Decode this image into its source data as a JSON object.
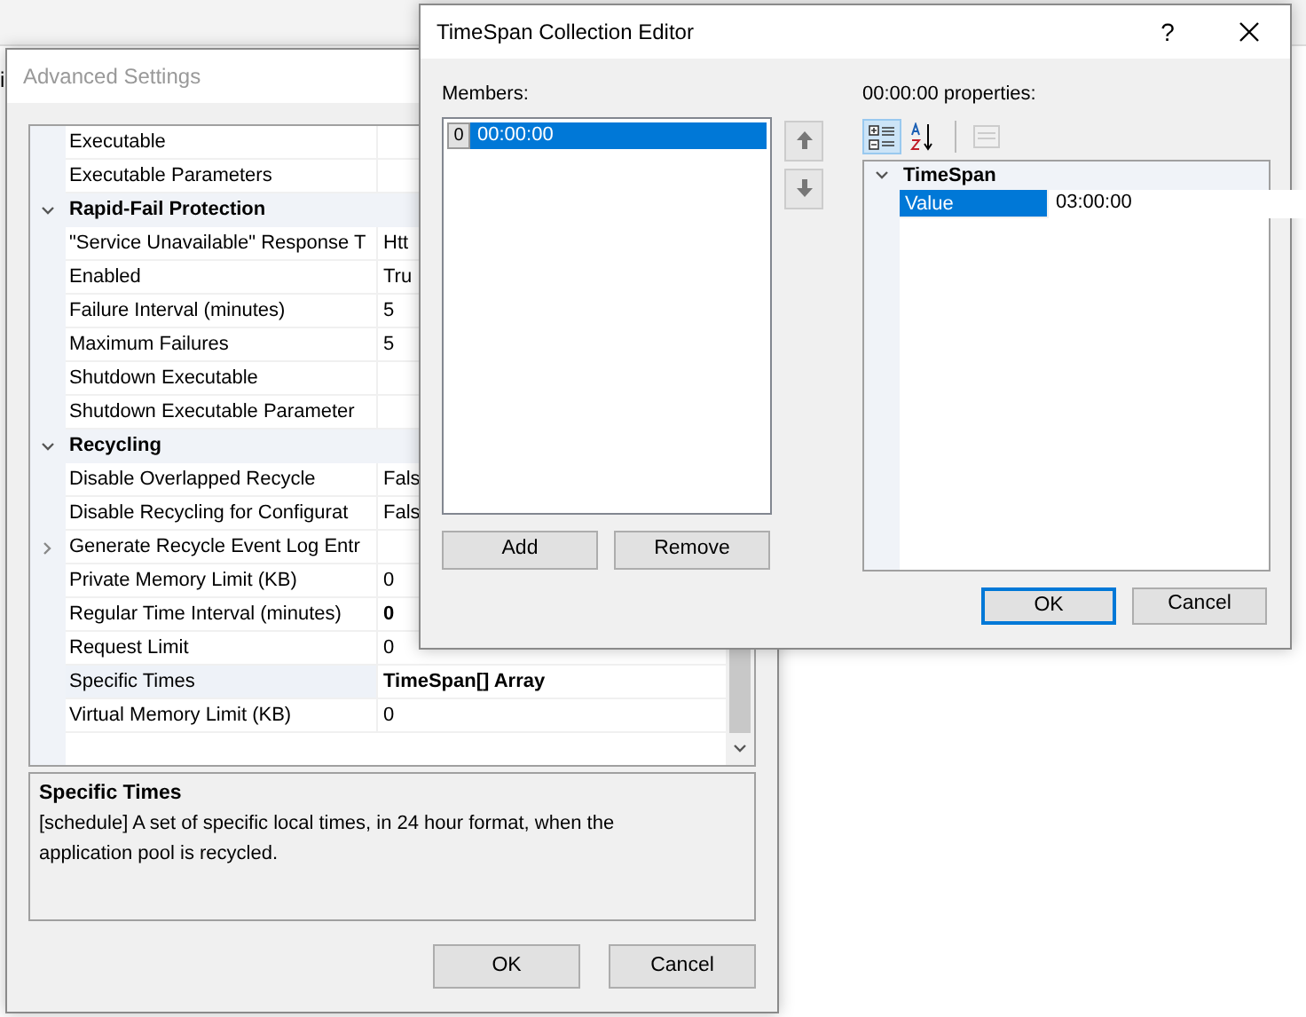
{
  "background_window": {
    "title": "i"
  },
  "advanced_settings": {
    "title": "Advanced Settings",
    "rows": [
      {
        "kind": "property",
        "label": "Executable",
        "selected": false
      },
      {
        "kind": "property",
        "label": "Executable Parameters",
        "selected": false
      },
      {
        "kind": "category",
        "label": "Rapid-Fail Protection",
        "expanded": true
      },
      {
        "kind": "property",
        "label": "\"Service Unavailable\" Response T",
        "value": "Htt",
        "modified": false,
        "selected": false
      },
      {
        "kind": "property",
        "label": "Enabled",
        "value": "Tru",
        "modified": false,
        "selected": false
      },
      {
        "kind": "property",
        "label": "Failure Interval (minutes)",
        "value": "5",
        "modified": false,
        "selected": false
      },
      {
        "kind": "property",
        "label": "Maximum Failures",
        "value": "5",
        "modified": false,
        "selected": false
      },
      {
        "kind": "property",
        "label": "Shutdown Executable",
        "selected": false
      },
      {
        "kind": "property",
        "label": "Shutdown Executable Parameter",
        "selected": false
      },
      {
        "kind": "category",
        "label": "Recycling",
        "expanded": true
      },
      {
        "kind": "property",
        "label": "Disable Overlapped Recycle",
        "value": "Fals",
        "modified": false,
        "selected": false
      },
      {
        "kind": "property",
        "label": "Disable Recycling for Configurat",
        "value": "Fals",
        "modified": false,
        "selected": false
      },
      {
        "kind": "group",
        "label": "Generate Recycle Event Log Entr",
        "expanded": false
      },
      {
        "kind": "property",
        "label": "Private Memory Limit (KB)",
        "value": "0",
        "modified": false,
        "selected": false
      },
      {
        "kind": "property",
        "label": "Regular Time Interval (minutes)",
        "value": "0",
        "modified": true,
        "selected": false
      },
      {
        "kind": "property",
        "label": "Request Limit",
        "value": "0",
        "modified": false,
        "selected": false
      },
      {
        "kind": "property",
        "label": "Specific Times",
        "value": "TimeSpan[] Array",
        "modified": true,
        "selected": true
      },
      {
        "kind": "property",
        "label": "Virtual Memory Limit (KB)",
        "value": "0",
        "modified": false,
        "selected": false
      }
    ],
    "description": {
      "title": "Specific Times",
      "text": "[schedule] A set of specific local times, in 24 hour format, when the application pool is recycled."
    },
    "buttons": [
      "OK",
      "Cancel"
    ]
  },
  "collection_editor": {
    "title": "TimeSpan Collection Editor",
    "help": "?",
    "members_label": "Members:",
    "members": [
      {
        "index": "0",
        "value": "00:00:00",
        "selected": true
      }
    ],
    "member_buttons": [
      "Add",
      "Remove"
    ],
    "properties_label": "00:00:00 properties:",
    "toolbar": [
      {
        "kind": "categorized",
        "selected": true,
        "disabled": false
      },
      {
        "kind": "alphabetical",
        "selected": false,
        "disabled": false
      },
      {
        "kind": "property-pages",
        "selected": false,
        "disabled": true
      }
    ],
    "grid": {
      "category": "TimeSpan",
      "expanded": true,
      "properties": [
        {
          "label": "Value",
          "value": "03:00:00",
          "selected": true
        }
      ]
    },
    "buttons": [
      {
        "label": "OK",
        "default": true
      },
      {
        "label": "Cancel",
        "default": false
      }
    ]
  }
}
